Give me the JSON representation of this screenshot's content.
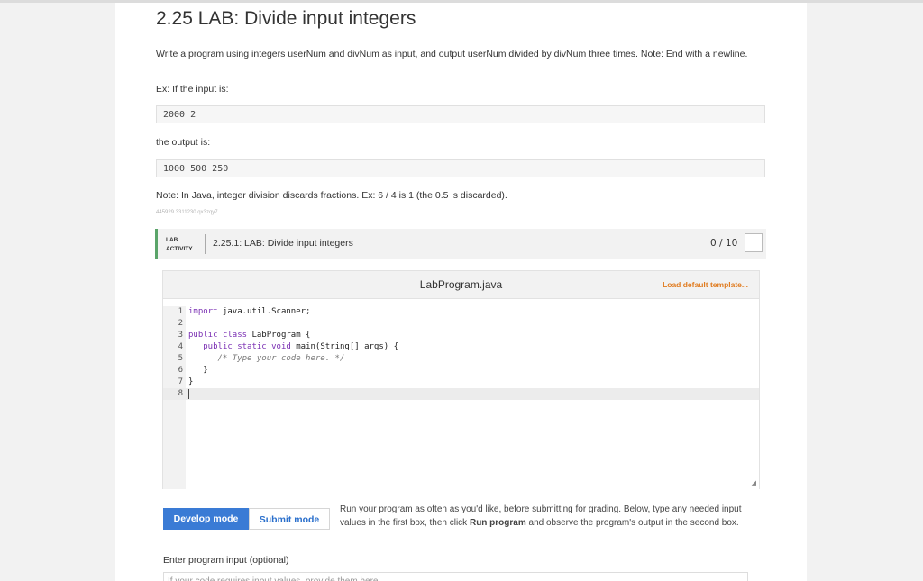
{
  "lab": {
    "title": "2.25 LAB: Divide input integers",
    "description": "Write a program using integers userNum and divNum as input, and output userNum divided by divNum three times. Note: End with a newline.",
    "example_label": "Ex: If the input is:",
    "example_input": "2000 2",
    "output_label": "the output is:",
    "example_output": "1000 500 250",
    "note": "Note: In Java, integer division discards fractions. Ex: 6 / 4 is 1 (the 0.5 is discarded).",
    "id_text": "445929.3311230.qx3zqy7"
  },
  "activity": {
    "tag_line1": "LAB",
    "tag_line2": "ACTIVITY",
    "name": "2.25.1: LAB: Divide input integers",
    "score": "0 / 10",
    "accent_color": "#5aa469"
  },
  "editor": {
    "filename": "LabProgram.java",
    "load_default": "Load default template...",
    "lines": [
      {
        "num": "1",
        "text": "import java.util.Scanner;"
      },
      {
        "num": "2",
        "text": ""
      },
      {
        "num": "3",
        "text": "public class LabProgram {"
      },
      {
        "num": "4",
        "text": "   public static void main(String[] args) {"
      },
      {
        "num": "5",
        "text": "      /* Type your code here. */"
      },
      {
        "num": "6",
        "text": "   }"
      },
      {
        "num": "7",
        "text": "}"
      },
      {
        "num": "8",
        "text": ""
      }
    ]
  },
  "modes": {
    "develop": "Develop mode",
    "submit": "Submit mode",
    "develop_color": "#3a7bd5"
  },
  "run_text": {
    "part1": "Run your program as often as you'd like, before submitting for grading. Below, type any needed input values in the first box, then click ",
    "bold1": "Run program",
    "part2": " and observe the program's output in the second box."
  },
  "program_input": {
    "label": "Enter program input (optional)",
    "placeholder": "If your code requires input values, provide them here."
  }
}
